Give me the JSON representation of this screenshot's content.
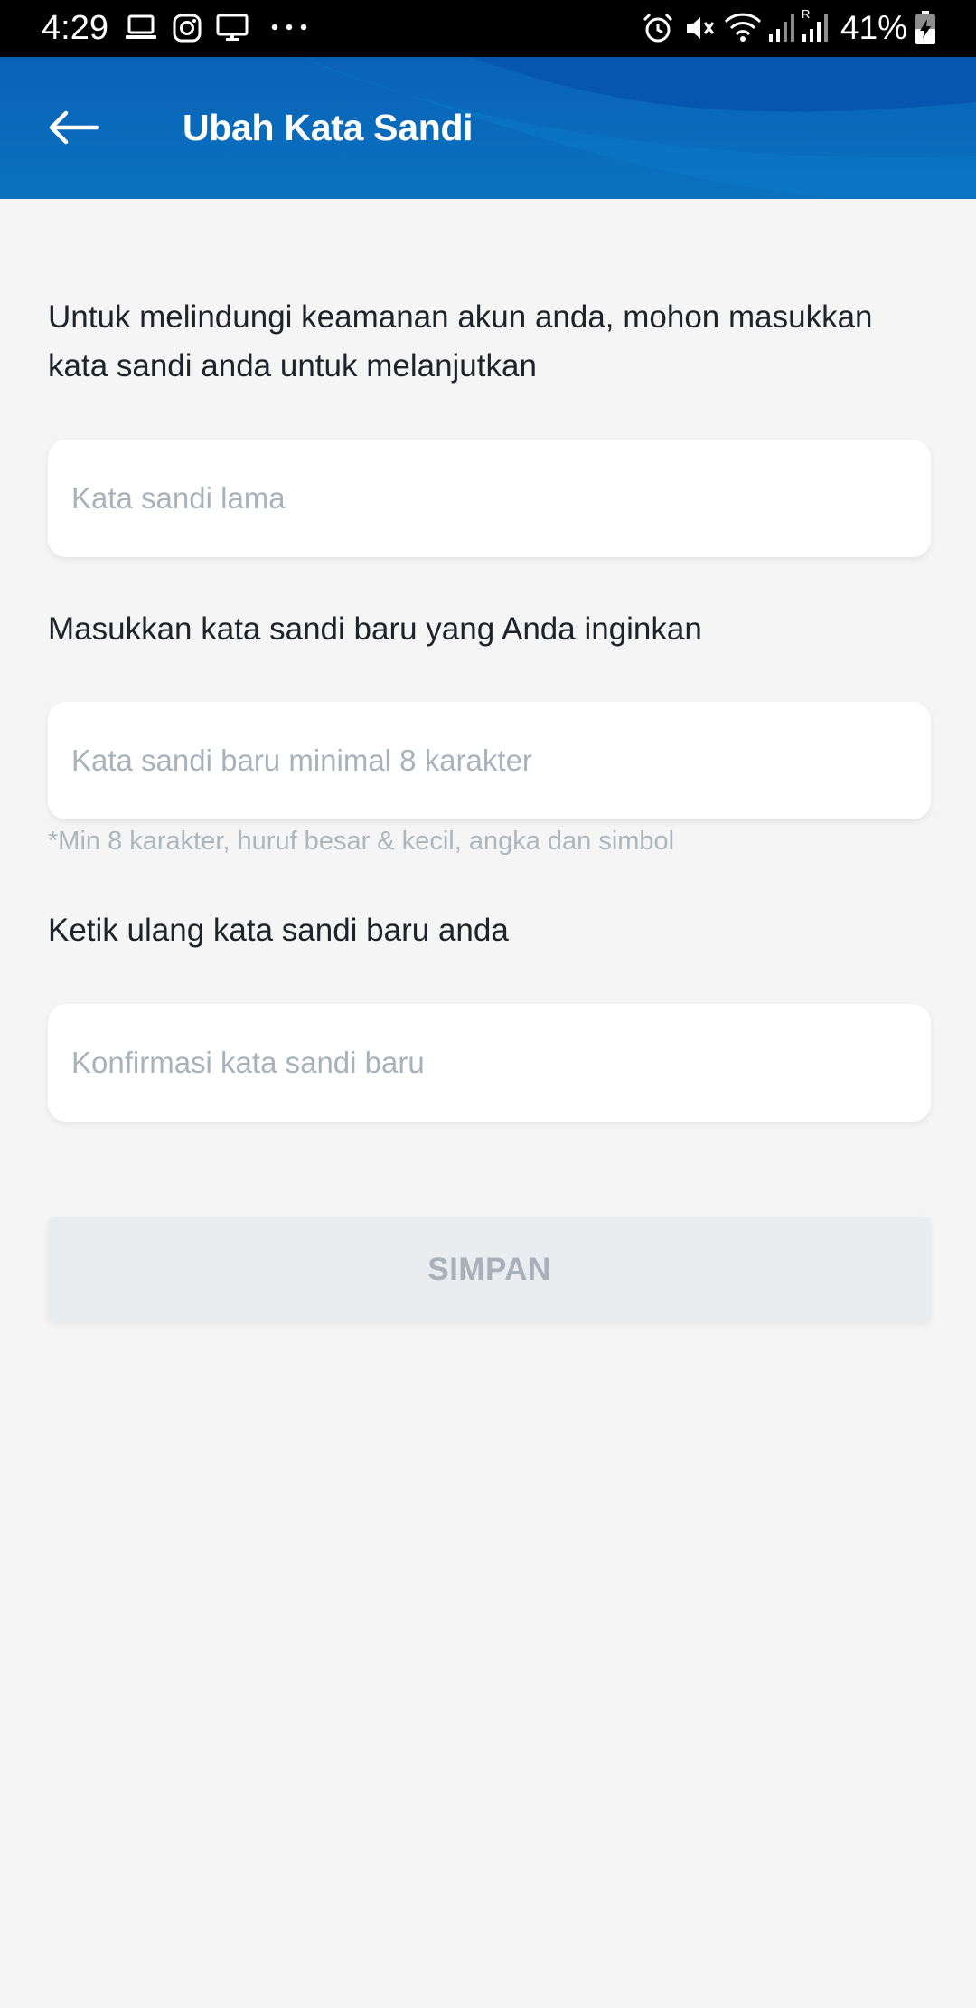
{
  "status_bar": {
    "time": "4:29",
    "battery_percent": "41%",
    "left_icons": [
      "laptop-icon",
      "instagram-icon",
      "monitor-icon",
      "more-dots-icon"
    ],
    "right_icons": [
      "alarm-icon",
      "mute-icon",
      "wifi-icon",
      "signal-icon",
      "signal-roaming-icon",
      "battery-charging-icon"
    ]
  },
  "header": {
    "title": "Ubah Kata Sandi",
    "back_icon": "arrow-left-icon",
    "background_color": "#0a6abb"
  },
  "form": {
    "intro_text": "Untuk melindungi keamanan akun anda, mohon masukkan kata sandi anda untuk melanjutkan",
    "old_password": {
      "placeholder": "Kata sandi lama",
      "value": ""
    },
    "new_password_label": "Masukkan kata sandi baru yang Anda inginkan",
    "new_password": {
      "placeholder": "Kata sandi baru minimal 8 karakter",
      "value": ""
    },
    "new_password_hint": "*Min 8 karakter, huruf besar & kecil, angka dan simbol",
    "confirm_label": "Ketik ulang kata sandi baru anda",
    "confirm_password": {
      "placeholder": "Konfirmasi kata sandi baru",
      "value": ""
    },
    "save_label": "SIMPAN"
  }
}
